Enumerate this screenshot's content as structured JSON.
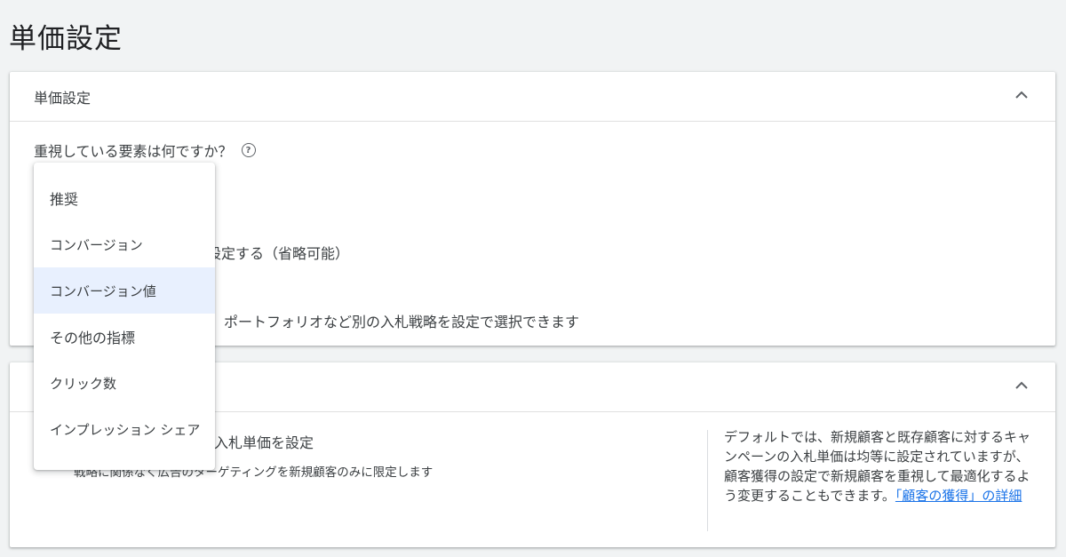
{
  "page": {
    "title": "単価設定"
  },
  "card1": {
    "title": "単価設定",
    "question": "重視している要素は何ですか？",
    "partial_text_1": "設定する（省略可能）",
    "partial_text_2": "ポートフォリオなど別の入札戦略を設定で選択できます"
  },
  "card2": {
    "partial_title": "入札単価を設定",
    "partial_desc": "戦略に関係なく広告のターゲティングを新規顧客のみに限定します",
    "info_text": "デフォルトでは、新規顧客と既存顧客に対するキャンペーンの入札単価は均等に設定されていますが、顧客獲得の設定で新規顧客を重視して最適化するよう変更することもできます。",
    "info_link": "「顧客の獲得」の詳細"
  },
  "dropdown": {
    "selected": "コンバージョン値",
    "items": [
      "推奨",
      "コンバージョン",
      "コンバージョン値",
      "その他の指標",
      "クリック数",
      "インプレッション シェア"
    ]
  },
  "icons": {
    "collapse": "chevron-up-icon",
    "help": "help-circle-icon"
  },
  "colors": {
    "link": "#1a73e8",
    "selected_bg": "#e8f0fe"
  }
}
